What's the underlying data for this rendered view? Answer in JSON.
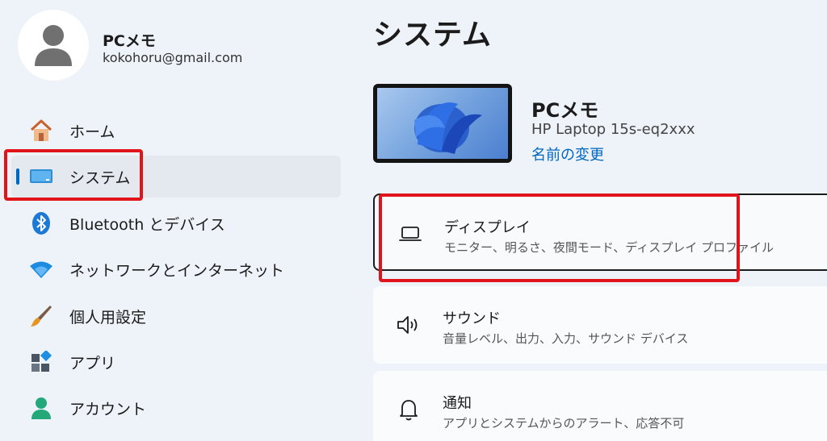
{
  "user": {
    "name": "PCメモ",
    "email": "kokohoru@gmail.com"
  },
  "sidebar": {
    "items": [
      {
        "label": "ホーム",
        "icon": "home-icon"
      },
      {
        "label": "システム",
        "icon": "system-icon",
        "selected": true
      },
      {
        "label": "Bluetooth とデバイス",
        "icon": "bluetooth-icon"
      },
      {
        "label": "ネットワークとインターネット",
        "icon": "wifi-icon"
      },
      {
        "label": "個人用設定",
        "icon": "brush-icon"
      },
      {
        "label": "アプリ",
        "icon": "apps-icon"
      },
      {
        "label": "アカウント",
        "icon": "account-icon"
      }
    ]
  },
  "main": {
    "title": "システム",
    "device": {
      "name": "PCメモ",
      "model": "HP Laptop 15s-eq2xxx",
      "rename_label": "名前の変更"
    },
    "cards": [
      {
        "title": "ディスプレイ",
        "description": "モニター、明るさ、夜間モード、ディスプレイ プロファイル",
        "icon": "display-icon"
      },
      {
        "title": "サウンド",
        "description": "音量レベル、出力、入力、サウンド デバイス",
        "icon": "sound-icon"
      },
      {
        "title": "通知",
        "description": "アプリとシステムからのアラート、応答不可",
        "icon": "bell-icon"
      }
    ]
  },
  "colors": {
    "accent": "#0067c0",
    "highlight": "#e1141b",
    "background": "#eef2f9"
  }
}
